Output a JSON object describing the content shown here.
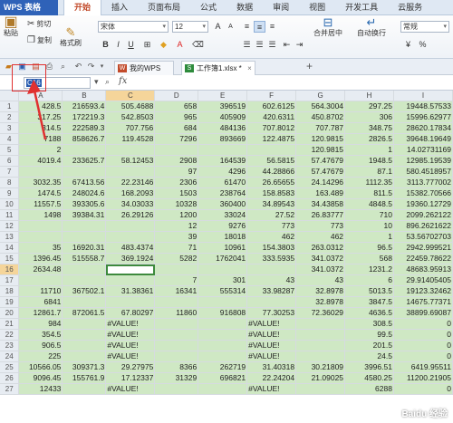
{
  "app": {
    "logo": "WPS 表格"
  },
  "menu": {
    "items": [
      "开始",
      "插入",
      "页面布局",
      "公式",
      "数据",
      "审阅",
      "视图",
      "开发工具",
      "云服务"
    ],
    "active_index": 0
  },
  "ribbon": {
    "paste_label": "粘贴",
    "cut_label": "剪切",
    "copy_label": "复制",
    "format_painter_label": "格式刷",
    "font_name": "宋体",
    "font_size": "12",
    "bold": "B",
    "italic": "I",
    "underline": "U",
    "merge_label": "合并居中",
    "wrap_label": "自动换行",
    "number_format": "常规",
    "currency_symbol": "¥",
    "percent_symbol": "%"
  },
  "tabs": {
    "items": [
      {
        "label": "我的WPS"
      },
      {
        "label": "工作簿1.xlsx *"
      }
    ],
    "active_index": 1,
    "add": "+"
  },
  "formula": {
    "name_box": "C16",
    "fx": "fx"
  },
  "columns": [
    "",
    "A",
    "B",
    "C",
    "D",
    "E",
    "F",
    "G",
    "H",
    "I"
  ],
  "selected": {
    "col": "C",
    "row": "16"
  },
  "rows": [
    {
      "n": "1",
      "c": [
        "428.5",
        "216593.4",
        "505.4688",
        "658",
        "396519",
        "602.6125",
        "564.3004",
        "297.25",
        "19448.57533"
      ]
    },
    {
      "n": "2",
      "c": [
        "317.25",
        "172219.3",
        "542.8503",
        "965",
        "405909",
        "420.6311",
        "450.8702",
        "306",
        "15996.62977"
      ]
    },
    {
      "n": "3",
      "c": [
        "314.5",
        "222589.3",
        "707.756",
        "684",
        "484136",
        "707.8012",
        "707.787",
        "348.75",
        "28620.17834"
      ]
    },
    {
      "n": "4",
      "c": [
        "7188",
        "858626.7",
        "119.4528",
        "7296",
        "893669",
        "122.4875",
        "120.9815",
        "2826.5",
        "39648.19649"
      ]
    },
    {
      "n": "5",
      "c": [
        "2",
        "",
        "",
        "",
        "",
        "",
        "120.9815",
        "1",
        "14.02731169"
      ]
    },
    {
      "n": "6",
      "c": [
        "4019.4",
        "233625.7",
        "58.12453",
        "2908",
        "164539",
        "56.5815",
        "57.47679",
        "1948.5",
        "12985.19539"
      ]
    },
    {
      "n": "7",
      "c": [
        "",
        "",
        "",
        "97",
        "4296",
        "44.28866",
        "57.47679",
        "87.1",
        "580.4518957"
      ]
    },
    {
      "n": "8",
      "c": [
        "3032.35",
        "67413.56",
        "22.23146",
        "2306",
        "61470",
        "26.65655",
        "24.14296",
        "1112.35",
        "3113.777002"
      ]
    },
    {
      "n": "9",
      "c": [
        "1474.5",
        "248024.6",
        "168.2093",
        "1503",
        "238764",
        "158.8583",
        "163.489",
        "811.5",
        "15382.70566"
      ]
    },
    {
      "n": "10",
      "c": [
        "11557.5",
        "393305.6",
        "34.03033",
        "10328",
        "360400",
        "34.89543",
        "34.43858",
        "4848.5",
        "19360.12729"
      ]
    },
    {
      "n": "11",
      "c": [
        "1498",
        "39384.31",
        "26.29126",
        "1200",
        "33024",
        "27.52",
        "26.83777",
        "710",
        "2099.262122"
      ]
    },
    {
      "n": "12",
      "c": [
        "",
        "",
        "",
        "12",
        "9276",
        "773",
        "773",
        "10",
        "896.2621622"
      ]
    },
    {
      "n": "13",
      "c": [
        "",
        "",
        "",
        "39",
        "18018",
        "462",
        "462",
        "1",
        "53.56702703"
      ]
    },
    {
      "n": "14",
      "c": [
        "35",
        "16920.31",
        "483.4374",
        "71",
        "10961",
        "154.3803",
        "263.0312",
        "96.5",
        "2942.999521"
      ]
    },
    {
      "n": "15",
      "c": [
        "1396.45",
        "515558.7",
        "369.1924",
        "5282",
        "1762041",
        "333.5935",
        "341.0372",
        "568",
        "22459.78622"
      ]
    },
    {
      "n": "16",
      "c": [
        "2634.48",
        "",
        "",
        "",
        "",
        "",
        "341.0372",
        "1231.2",
        "48683.95913"
      ]
    },
    {
      "n": "17",
      "c": [
        "",
        "",
        "",
        "7",
        "301",
        "43",
        "43",
        "6",
        "29.91405405"
      ]
    },
    {
      "n": "18",
      "c": [
        "11710",
        "367502.1",
        "31.38361",
        "16341",
        "555314",
        "33.98287",
        "32.8978",
        "5013.5",
        "19123.32462"
      ]
    },
    {
      "n": "19",
      "c": [
        "6841",
        "",
        "",
        "",
        "",
        "",
        "32.8978",
        "3847.5",
        "14675.77371"
      ]
    },
    {
      "n": "20",
      "c": [
        "12861.7",
        "872061.5",
        "67.80297",
        "11860",
        "916808",
        "77.30253",
        "72.36029",
        "4636.5",
        "38899.69087"
      ]
    },
    {
      "n": "21",
      "c": [
        "984",
        "",
        "#VALUE!",
        "",
        "",
        "#VALUE!",
        "",
        "308.5",
        "0"
      ]
    },
    {
      "n": "22",
      "c": [
        "354.5",
        "",
        "#VALUE!",
        "",
        "",
        "#VALUE!",
        "",
        "99.5",
        "0"
      ]
    },
    {
      "n": "23",
      "c": [
        "906.5",
        "",
        "#VALUE!",
        "",
        "",
        "#VALUE!",
        "",
        "201.5",
        "0"
      ]
    },
    {
      "n": "24",
      "c": [
        "225",
        "",
        "#VALUE!",
        "",
        "",
        "#VALUE!",
        "",
        "24.5",
        "0"
      ]
    },
    {
      "n": "25",
      "c": [
        "10566.05",
        "309371.3",
        "29.27975",
        "8366",
        "262719",
        "31.40318",
        "30.21809",
        "3996.51",
        "6419.95511"
      ]
    },
    {
      "n": "26",
      "c": [
        "9096.45",
        "155761.9",
        "17.12337",
        "31329",
        "696821",
        "22.24204",
        "21.09025",
        "4580.25",
        "11200.21905"
      ]
    },
    {
      "n": "27",
      "c": [
        "12433",
        "",
        "#VALUE!",
        "",
        "",
        "#VALUE!",
        "",
        "6288",
        "0"
      ]
    }
  ],
  "watermark": "Baidu 经验"
}
